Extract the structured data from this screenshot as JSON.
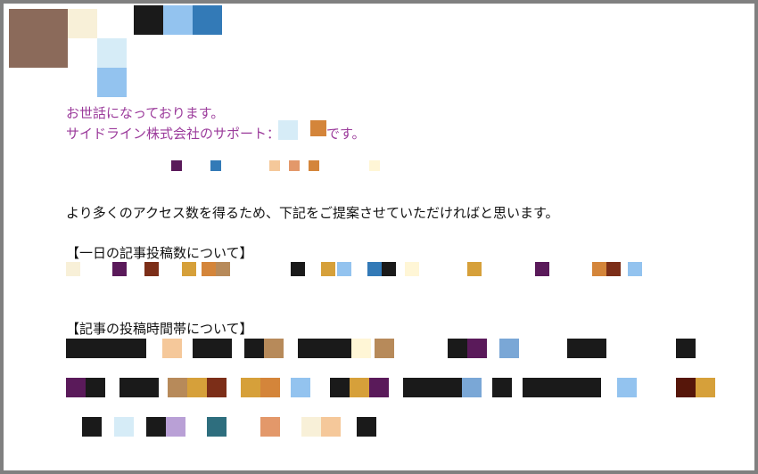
{
  "greeting": {
    "line1": "お世話になっております。",
    "line2_prefix": "サイドライン株式会社のサポート：",
    "line2_suffix": "です。"
  },
  "body": {
    "intro": "より多くのアクセス数を得るため、下記をご提案させていただければと思います。",
    "section1_title": "【一日の記事投稿数について】",
    "section2_title": "【記事の投稿時間帯について】"
  },
  "colors": {
    "brown": "#8b6a5a",
    "ivory": "#f8f0d8",
    "paleblue": "#d6ecf7",
    "skyblue": "#93c3ef",
    "darkgray": "#1a1a1a",
    "steel": "#337ab7",
    "lightsteel": "#7aa7d6",
    "plum": "#5a1a5a",
    "maroon": "#7c2e18",
    "tan": "#b78a5a",
    "teal": "#2e6e7e",
    "cream": "#fff6d6",
    "lilac": "#b9a0d6",
    "salmon": "#e3986a",
    "peach": "#f5c89a",
    "gold": "#d6a03a",
    "orange": "#d4853a",
    "darkred": "#56160a"
  }
}
